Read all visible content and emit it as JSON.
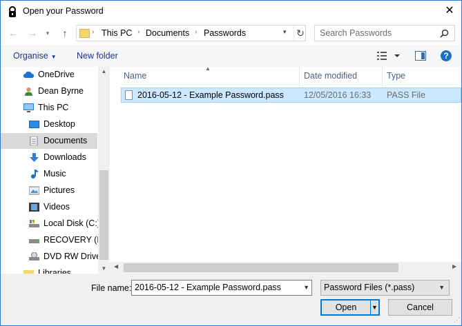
{
  "window": {
    "title": "Open your Password",
    "close_glyph": "✕"
  },
  "nav": {
    "back_glyph": "←",
    "forward_glyph": "→",
    "recent_glyph": "▾",
    "up_glyph": "↑",
    "breadcrumb": [
      "This PC",
      "Documents",
      "Passwords"
    ],
    "separator_glyph": "›",
    "refresh_glyph": "↻",
    "search_placeholder": "Search Passwords"
  },
  "toolbar": {
    "organise": "Organise",
    "new_folder": "New folder",
    "help": "?"
  },
  "sidebar": {
    "items": [
      {
        "label": "OneDrive",
        "icon": "cloud-icon"
      },
      {
        "label": "Dean Byrne",
        "icon": "user-icon"
      },
      {
        "label": "This PC",
        "icon": "computer-icon"
      },
      {
        "label": "Desktop",
        "icon": "desktop-icon"
      },
      {
        "label": "Documents",
        "icon": "documents-icon",
        "selected": true
      },
      {
        "label": "Downloads",
        "icon": "download-icon"
      },
      {
        "label": "Music",
        "icon": "music-icon"
      },
      {
        "label": "Pictures",
        "icon": "pictures-icon"
      },
      {
        "label": "Videos",
        "icon": "videos-icon"
      },
      {
        "label": "Local Disk (C:)",
        "icon": "disk-icon"
      },
      {
        "label": "RECOVERY (D:)",
        "icon": "drive-icon"
      },
      {
        "label": "DVD RW Drive",
        "icon": "dvd-icon"
      },
      {
        "label": "Libraries",
        "icon": "libraries-icon"
      }
    ]
  },
  "columns": {
    "name": "Name",
    "date": "Date modified",
    "type": "Type"
  },
  "files": [
    {
      "name": "2016-05-12 - Example Password.pass",
      "date": "12/05/2016 16:33",
      "type": "PASS File",
      "selected": true
    }
  ],
  "bottom": {
    "filename_label": "File name:",
    "filename_value": "2016-05-12 - Example Password.pass",
    "filter_value": "Password Files (*.pass)",
    "open_label": "Open",
    "cancel_label": "Cancel"
  },
  "colors": {
    "accent": "#0078d7",
    "selection": "#cce8ff",
    "toolbar_text": "#1e3287"
  }
}
